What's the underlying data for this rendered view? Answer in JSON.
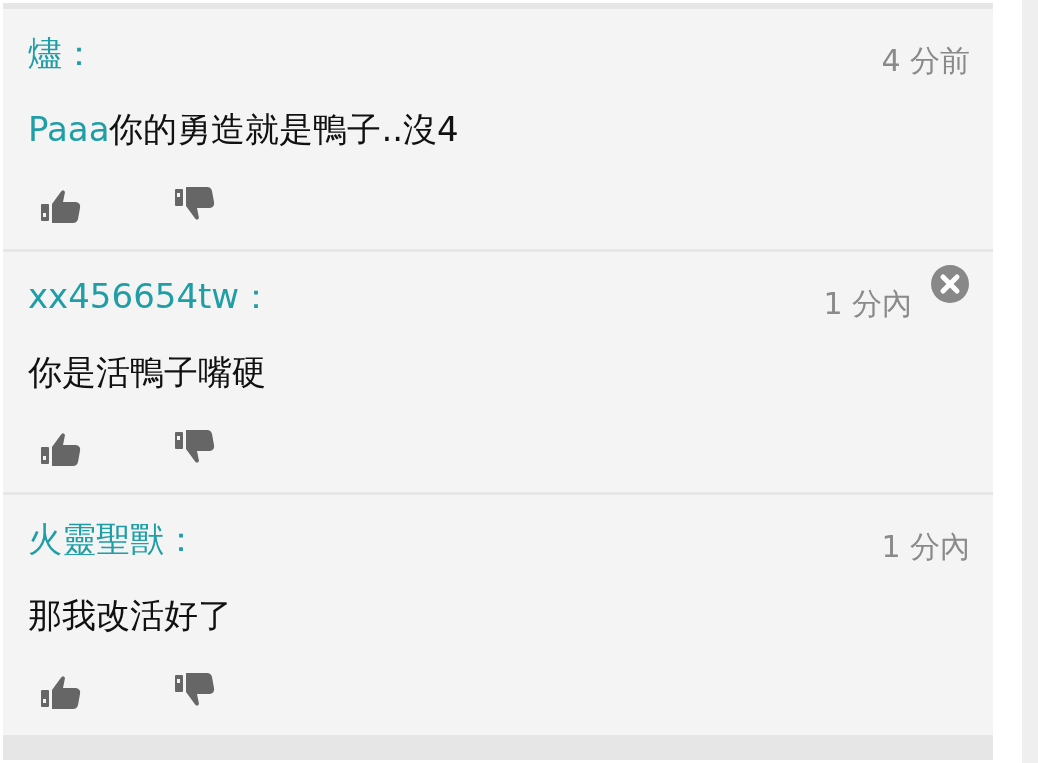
{
  "comments": [
    {
      "user": "燼：",
      "time": "4 分前",
      "mention": "Paaa",
      "text": "你的勇造就是鴨子..沒4",
      "deletable": false
    },
    {
      "user": "xx456654tw：",
      "time": "1 分內",
      "text": "你是活鴨子嘴硬",
      "deletable": true
    },
    {
      "user": "火靈聖獸：",
      "time": "1 分內",
      "text": "那我改活好了",
      "deletable": false
    }
  ]
}
